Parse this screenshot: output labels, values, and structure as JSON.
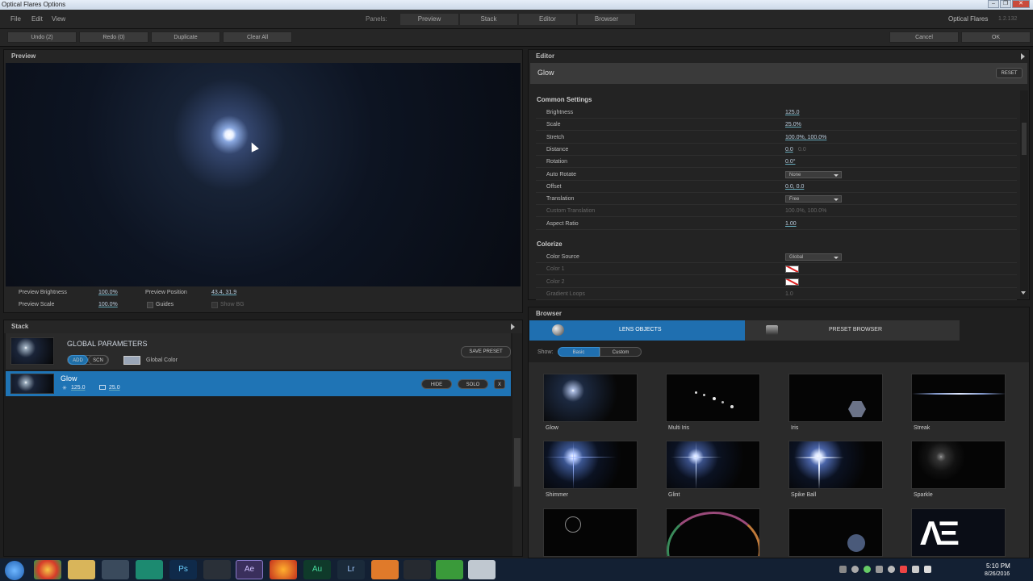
{
  "window": {
    "title": "Optical Flares Options",
    "controls": [
      "–",
      "❐",
      "✕"
    ]
  },
  "menu": {
    "items": [
      "File",
      "Edit",
      "View"
    ],
    "panels_label": "Panels:",
    "panels": [
      "Preview",
      "Stack",
      "Editor",
      "Browser"
    ],
    "brand": "Optical Flares",
    "version": "1.2.132"
  },
  "toolbar": {
    "undo": "Undo (2)",
    "redo": "Redo (0)",
    "duplicate": "Duplicate",
    "clear_all": "Clear All",
    "cancel": "Cancel",
    "ok": "OK"
  },
  "preview": {
    "title": "Preview",
    "brightness_label": "Preview Brightness",
    "brightness_value": "100.0%",
    "scale_label": "Preview Scale",
    "scale_value": "100.0%",
    "position_label": "Preview Position",
    "position_value": "43.4, 31.9",
    "guides_label": "Guides",
    "show_bg_label": "Show BG"
  },
  "stack": {
    "title": "Stack",
    "global": {
      "title": "GLOBAL PARAMETERS",
      "add": "ADD",
      "scn": "SCN",
      "global_color": "Global Color",
      "save_preset": "SAVE PRESET"
    },
    "item": {
      "name": "Glow",
      "brightness": "125.0",
      "scale": "25.0",
      "hide": "HIDE",
      "solo": "SOLO",
      "remove": "X"
    }
  },
  "editor": {
    "title": "Editor",
    "object_name": "Glow",
    "reset": "RESET",
    "common_title": "Common Settings",
    "common": [
      {
        "label": "Brightness",
        "value": "125.0"
      },
      {
        "label": "Scale",
        "value": "25.0%"
      },
      {
        "label": "Stretch",
        "value": "100.0%, 100.0%"
      },
      {
        "label": "Distance",
        "value": "0.0",
        "value2": "0.0"
      },
      {
        "label": "Rotation",
        "value": "0.0°"
      },
      {
        "label": "Auto Rotate",
        "select": "None"
      },
      {
        "label": "Offset",
        "value": "0.0, 0.0"
      },
      {
        "label": "Translation",
        "select": "Free"
      },
      {
        "label": "Custom Translation",
        "value": "100.0%, 100.0%",
        "disabled": true
      },
      {
        "label": "Aspect Ratio",
        "value": "1.00"
      }
    ],
    "colorize_title": "Colorize",
    "colorize": [
      {
        "label": "Color Source",
        "select": "Global"
      },
      {
        "label": "Color 1",
        "swatch": true,
        "disabled": true
      },
      {
        "label": "Color 2",
        "swatch": true,
        "disabled": true
      },
      {
        "label": "Gradient Loops",
        "value": "1.0",
        "disabled": true
      }
    ]
  },
  "browser": {
    "title": "Browser",
    "tab_lens": "LENS OBJECTS",
    "tab_preset": "PRESET BROWSER",
    "show_label": "Show:",
    "basic": "Basic",
    "custom": "Custom",
    "items": [
      "Glow",
      "Multi Iris",
      "Iris",
      "Streak",
      "Shimmer",
      "Glint",
      "Spike Ball",
      "Sparkle"
    ]
  },
  "taskbar": {
    "time": "5:10 PM",
    "date": "8/26/2016",
    "apps": [
      "Ps",
      "Ae",
      "Au",
      "Lr"
    ]
  }
}
